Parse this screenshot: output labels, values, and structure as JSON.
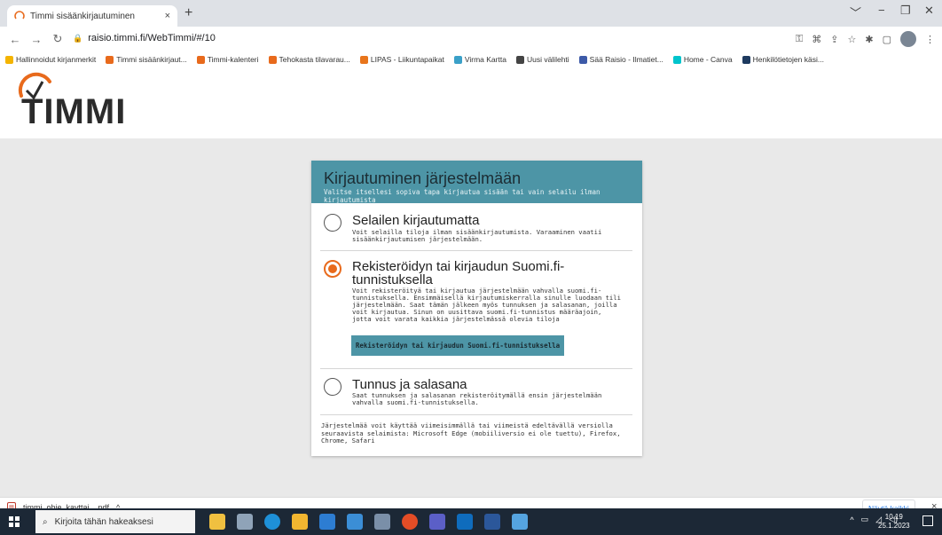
{
  "browser": {
    "tab_title": "Timmi sisäänkirjautuminen",
    "tab_close": "×",
    "new_tab": "+",
    "url": "raisio.timmi.fi/WebTimmi/#/10",
    "window_controls": [
      "﹀",
      "−",
      "❐",
      "✕"
    ]
  },
  "bookmarks": [
    {
      "label": "Hallinnoidut kirjanmerkit",
      "color": "#f4b400"
    },
    {
      "label": "Timmi sisäänkirjaut...",
      "color": "#e86a1c"
    },
    {
      "label": "Timmi-kalenteri",
      "color": "#e86a1c"
    },
    {
      "label": "Tehokasta tilavarau...",
      "color": "#e86a1c"
    },
    {
      "label": "LIPAS - Liikuntapaikat",
      "color": "#e8751c"
    },
    {
      "label": "Virma Kartta",
      "color": "#3aa0c8"
    },
    {
      "label": "Uusi välilehti",
      "color": "#444444"
    },
    {
      "label": "Sää Raisio - Ilmatiet...",
      "color": "#3d5aa8"
    },
    {
      "label": "Home - Canva",
      "color": "#00c4cc"
    },
    {
      "label": "Henkilötietojen käsi...",
      "color": "#1e3a5f"
    }
  ],
  "site": {
    "logo_text": "TIMMI",
    "accent": "#e86a1c",
    "header_color": "#4d95a6"
  },
  "login": {
    "title": "Kirjautuminen järjestelmään",
    "subtitle": "Valitse itsellesi sopiva tapa kirjautua sisään tai vain selailu ilman kirjautumista",
    "options": [
      {
        "title": "Selailen kirjautumatta",
        "desc": "Voit selailla tiloja ilman sisäänkirjautumista. Varaaminen vaatii sisäänkirjautumisen järjestelmään.",
        "selected": false
      },
      {
        "title": "Rekisteröidyn tai kirjaudun Suomi.fi-tunnistuksella",
        "desc": "Voit rekisteröityä tai kirjautua järjestelmään vahvalla suomi.fi-tunnistuksella. Ensimmäisellä kirjautumiskerralla sinulle luodaan tili järjestelmään. Saat tämän jälkeen myös tunnuksen ja salasanan, joilla voit kirjautua. Sinun on uusittava suomi.fi-tunnistus määräajoin, jotta voit varata kaikkia järjestelmässä olevia tiloja",
        "selected": true,
        "button": "Rekisteröidyn tai kirjaudun Suomi.fi-tunnistuksella"
      },
      {
        "title": "Tunnus ja salasana",
        "desc": "Saat tunnuksen ja salasanan rekisteröitymällä ensin järjestelmään vahvalla suomi.fi-tunnistuksella.",
        "selected": false
      }
    ],
    "footnote": "Järjestelmää voit käyttää viimeisimmällä tai viimeistä edeltävällä versiolla seuraavista selaimista: Microsoft Edge (mobiiliversio ei ole tuettu), Firefox, Chrome, Safari"
  },
  "downloads": {
    "file": "timmi_ohje_kayttaj....pdf",
    "chevron": "^",
    "show_all": "Näytä kaikki",
    "close": "×"
  },
  "taskbar": {
    "search_placeholder": "Kirjoita tähän hakeaksesi",
    "time": "10.19",
    "date": "25.1.2023"
  }
}
